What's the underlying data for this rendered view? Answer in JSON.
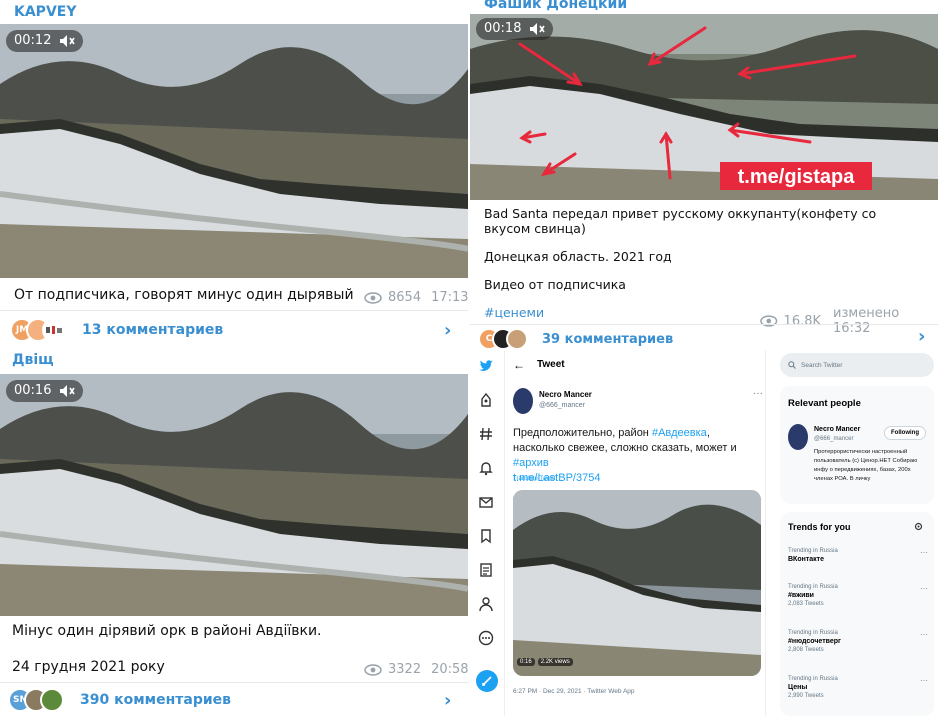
{
  "left_top": {
    "channel": "KAPVEY",
    "duration": "00:12",
    "caption": "От подписчика, говорят минус один дырявый",
    "views": "8654",
    "time": "17:13",
    "avatar_initials": "JM",
    "comments": "13 комментариев"
  },
  "left_bottom": {
    "channel": "Двіщ",
    "duration": "00:16",
    "caption": "Мінус один дірявий орк в районі Авдіївки.",
    "date_line": "24 грудня 2021 року",
    "views": "3322",
    "time": "20:58",
    "avatar_initials": "SN",
    "comments": "390 комментариев"
  },
  "right_top": {
    "channel": "Фашик Донецкий",
    "duration": "00:18",
    "watermark": "t.me/gistapa",
    "caption_line1": "Bad Santa передал привет русскому оккупанту(конфету со вкусом свинца)",
    "caption_line2": "Донецкая область. 2021 год",
    "caption_line3": "Видео от подписчика",
    "hashtag": "#ценеми",
    "views": "16.8K",
    "edited_time": "изменено 16:32",
    "avatar_initials": "C",
    "comments": "39 комментариев"
  },
  "tweet": {
    "header": "Tweet",
    "author_name": "Necro Mancer",
    "author_handle": "@666_mancer",
    "text_plain1": "Предположительно, район ",
    "tag1": "#Авдеевка",
    "text_plain2": ", насколько свежее, сложно сказать, может и ",
    "tag2": "#архив",
    "link": "t.me/LastBP/3754",
    "translate": "Translate Tweet",
    "video_time": "0:16",
    "video_views": "2.2K views",
    "footer": "6:27 PM · Dec 29, 2021 · Twitter Web App",
    "search_placeholder": "Search Twitter",
    "relevant_title": "Relevant people",
    "relevant_name": "Necro Mancer",
    "relevant_handle": "@666_mancer",
    "follow_label": "Following",
    "bio": "Протеррористически настроенный пользователь (с) Ценор.НЕТ Собираю инфу о передвижениях, базах, 200х членах РОА. В личку",
    "trends_title": "Trends for you",
    "trends": [
      {
        "context": "Trending in Russia",
        "name": "ВКонтакте",
        "count": ""
      },
      {
        "context": "Trending in Russia",
        "name": "#вживи",
        "count": "2,083 Tweets"
      },
      {
        "context": "Trending in Russia",
        "name": "#нюдсочетверг",
        "count": "2,808 Tweets"
      },
      {
        "context": "Trending in Russia",
        "name": "Цены",
        "count": "2,990 Tweets"
      }
    ]
  },
  "colors": {
    "telegram_accent": "#3a8fd0",
    "twitter_accent": "#1da1f2",
    "arrow_red": "#e8283c"
  }
}
